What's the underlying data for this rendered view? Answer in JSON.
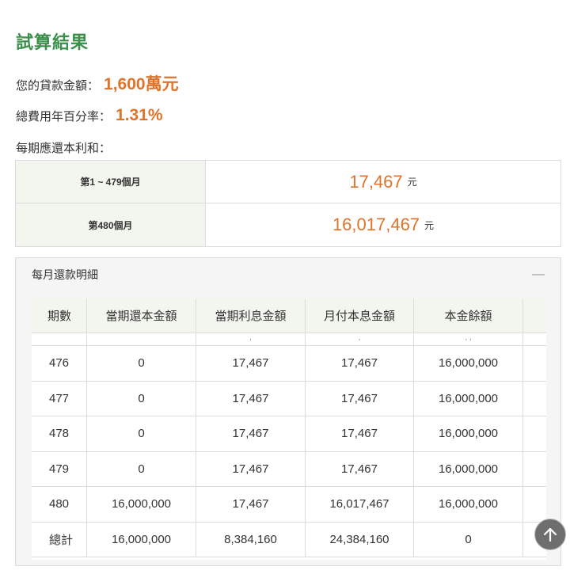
{
  "title": "試算結果",
  "loan": {
    "label": "您的貸款金額：",
    "value": "1,600萬元"
  },
  "apr": {
    "label": "總費用年百分率：",
    "value": "1.31%"
  },
  "installment_label": "每期應還本利和：",
  "summary": [
    {
      "period": "第1 ~ 479個月",
      "amount": "17,467",
      "unit": "元"
    },
    {
      "period": "第480個月",
      "amount": "16,017,467",
      "unit": "元"
    }
  ],
  "detail": {
    "title": "每月還款明細",
    "collapse_symbol": "—",
    "headers": [
      "期數",
      "當期還本金額",
      "當期利息金額",
      "月付本息金額",
      "本金餘額"
    ],
    "clipped_row": [
      "",
      "",
      ",",
      ",",
      ",  ,"
    ],
    "rows": [
      [
        "476",
        "0",
        "17,467",
        "17,467",
        "16,000,000"
      ],
      [
        "477",
        "0",
        "17,467",
        "17,467",
        "16,000,000"
      ],
      [
        "478",
        "0",
        "17,467",
        "17,467",
        "16,000,000"
      ],
      [
        "479",
        "0",
        "17,467",
        "17,467",
        "16,000,000"
      ],
      [
        "480",
        "16,000,000",
        "17,467",
        "16,017,467",
        "16,000,000"
      ],
      [
        "總計",
        "16,000,000",
        "8,384,160",
        "24,384,160",
        "0"
      ]
    ]
  },
  "colors": {
    "accent_green": "#3a8f4a",
    "accent_orange": "#e0732a"
  },
  "icons": {
    "scroll_top": "arrow-up-icon"
  }
}
